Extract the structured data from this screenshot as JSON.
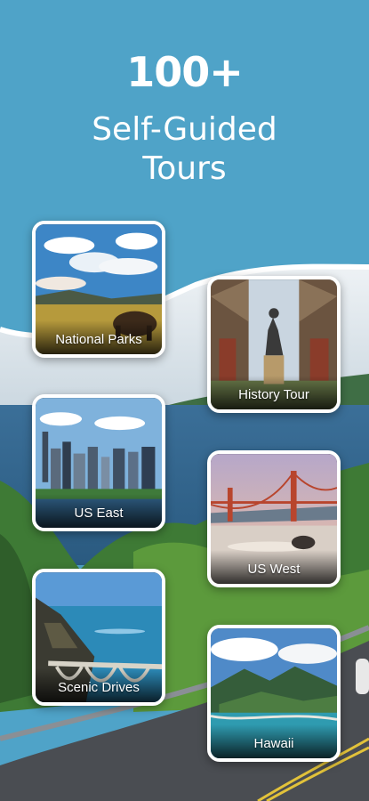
{
  "hero": {
    "count": "100+",
    "subtitle_line1": "Self-Guided",
    "subtitle_line2": "Tours"
  },
  "colors": {
    "sky_band": "#4fa3c8",
    "card_border": "#ffffff"
  },
  "tours": [
    {
      "label": "National Parks",
      "icon": "bison-prairie-image"
    },
    {
      "label": "History Tour",
      "icon": "statue-park-image"
    },
    {
      "label": "US East",
      "icon": "city-skyline-image"
    },
    {
      "label": "US West",
      "icon": "golden-gate-bridge-image"
    },
    {
      "label": "Scenic Drives",
      "icon": "coastal-bridge-image"
    },
    {
      "label": "Hawaii",
      "icon": "island-mountains-image"
    }
  ]
}
